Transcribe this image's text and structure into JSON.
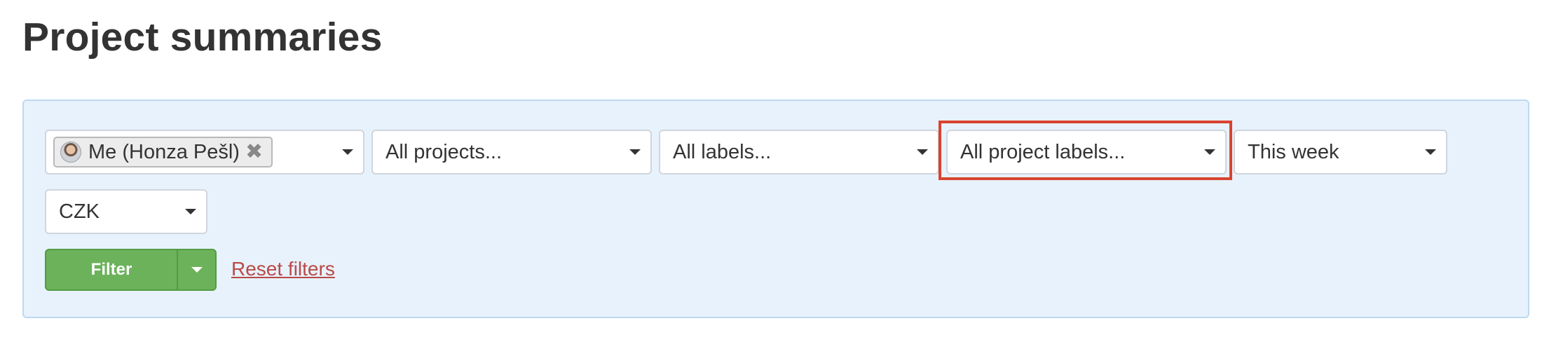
{
  "page": {
    "title": "Project summaries"
  },
  "filters": {
    "user_select": {
      "chip_label": "Me (Honza Pešl)",
      "remove_symbol": "✖",
      "avatar_icon": "user-avatar"
    },
    "projects_select": {
      "value": "All projects..."
    },
    "labels_select": {
      "value": "All labels..."
    },
    "project_labels_select": {
      "value": "All project labels...",
      "highlighted": true,
      "highlight_color": "#d9432f"
    },
    "period_select": {
      "value": "This week"
    },
    "currency_select": {
      "value": "CZK"
    }
  },
  "actions": {
    "filter_label": "Filter",
    "reset_label": "Reset filters"
  },
  "colors": {
    "panel_background": "#e8f2fc",
    "panel_border": "#bcd9f2",
    "filter_button": "#6cb25b",
    "reset_link": "#b94a48"
  }
}
